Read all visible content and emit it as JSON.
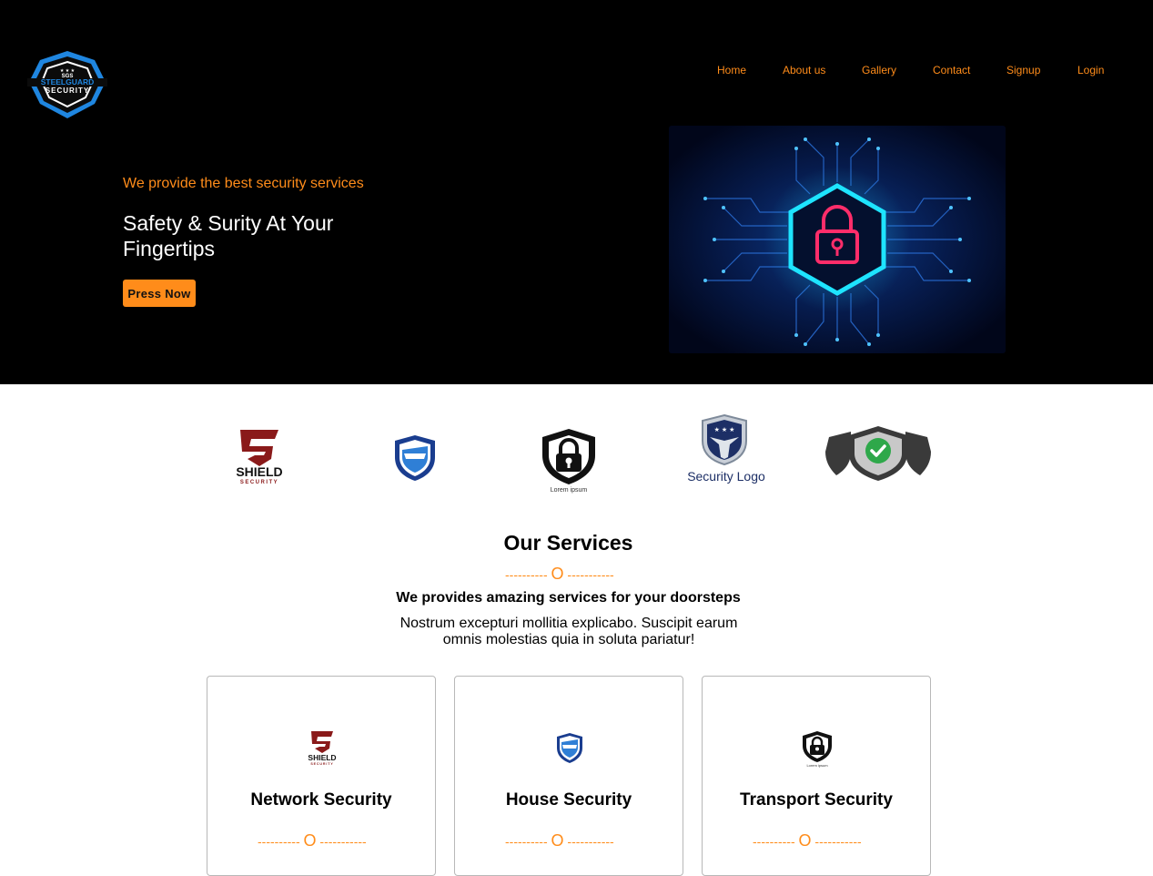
{
  "brand": {
    "name": "STEELGUARD",
    "subname": "SECURITY",
    "initials": "SGS",
    "logo_icon": "shield-logo"
  },
  "nav": {
    "items": [
      {
        "label": "Home"
      },
      {
        "label": "About us"
      },
      {
        "label": "Gallery"
      },
      {
        "label": "Contact"
      },
      {
        "label": "Signup"
      },
      {
        "label": "Login"
      }
    ]
  },
  "hero": {
    "tagline": "We provide the best security services",
    "title": "Safety & Surity At Your Fingertips",
    "cta_label": "Press Now",
    "image_icon": "padlock-circuit-icon"
  },
  "partners": [
    {
      "icon": "shield-security-logo",
      "word": "SHIELD",
      "small": "SECURITY"
    },
    {
      "icon": "blue-shield-logo"
    },
    {
      "icon": "padlock-shield-logo",
      "small": "Lorem ipsum"
    },
    {
      "icon": "eagle-shield-logo",
      "word": "Security Logo"
    },
    {
      "icon": "check-shield-logo"
    }
  ],
  "services": {
    "title": "Our Services",
    "divider_left": "----------",
    "divider_mark": "O",
    "divider_right": "-----------",
    "subtitle": "We provides amazing services for your doorsteps",
    "description": "Nostrum excepturi mollitia explicabo. Suscipit earum omnis molestias quia in soluta pariatur!",
    "cards": [
      {
        "title": "Network Security",
        "icon": "shield-security-logo"
      },
      {
        "title": "House Security",
        "icon": "blue-shield-logo"
      },
      {
        "title": "Transport Security",
        "icon": "padlock-shield-logo"
      }
    ]
  },
  "colors": {
    "accent": "#ff8c1a",
    "hero_bg": "#000000",
    "neon_cyan": "#1ee4ff",
    "lock_red": "#ff2d6a"
  }
}
